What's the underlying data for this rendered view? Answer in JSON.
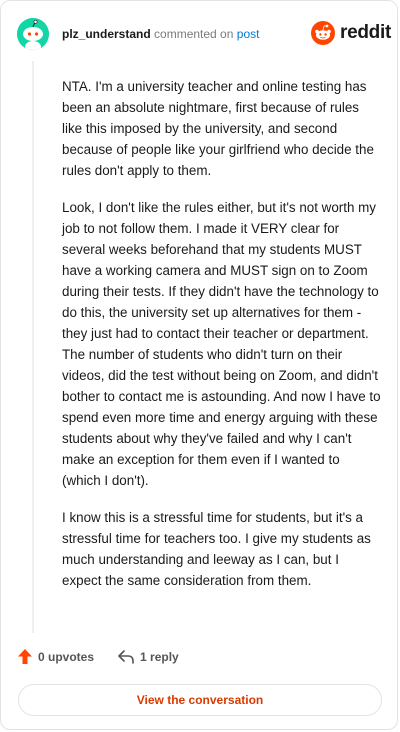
{
  "header": {
    "username": "plz_understand",
    "action_text": "commented on",
    "post_link": "post",
    "brand": "reddit"
  },
  "comment": {
    "paragraphs": [
      "NTA. I'm a university teacher and online testing has been an absolute nightmare, first because of rules like this imposed by the university, and second because of people like your girlfriend who decide the rules don't apply to them.",
      "Look, I don't like the rules either, but it's not worth my job to not follow them. I made it VERY clear for several weeks beforehand that my students MUST have a working camera and MUST sign on to Zoom during their tests. If they didn't have the technology to do this, the university set up alternatives for them - they just had to contact their teacher or department. The number of students who didn't turn on their videos, did the test without being on Zoom, and didn't bother to contact me is astounding. And now I have to spend even more time and energy arguing with these students about why they've failed and why I can't make an exception for them even if I wanted to (which I don't).",
      "I know this is a stressful time for students, but it's a stressful time for teachers too. I give my students as much understanding and leeway as I can, but I expect the same consideration from them."
    ]
  },
  "actions": {
    "upvotes_label": "0 upvotes",
    "reply_label": "1 reply"
  },
  "footer": {
    "view_conversation_label": "View the conversation"
  },
  "colors": {
    "avatar_bg": "#12d6a5",
    "brand_orange": "#ff4500",
    "link_blue": "#0079d3",
    "button_text": "#d93a00"
  },
  "icons": {
    "avatar": "snoo-avatar-icon",
    "logo": "reddit-logo-icon",
    "upvote": "upvote-arrow-icon",
    "reply": "reply-arrow-icon"
  }
}
